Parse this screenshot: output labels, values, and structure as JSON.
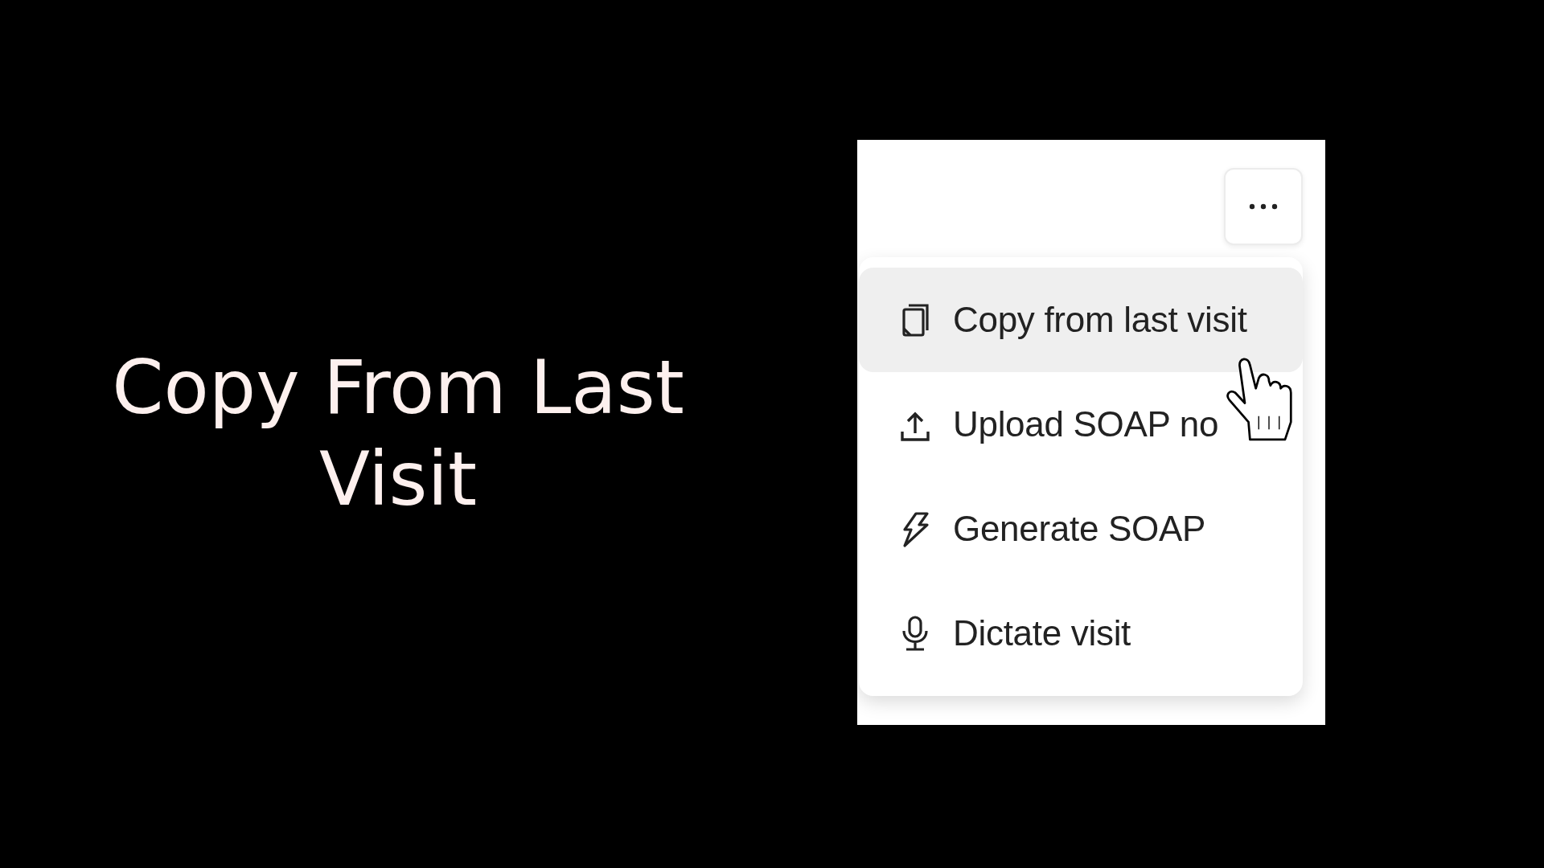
{
  "title": "Copy From Last Visit",
  "menu": {
    "items": [
      {
        "kind": "copy",
        "label": "Copy from last visit",
        "selected": true
      },
      {
        "kind": "upload",
        "label": "Upload SOAP no",
        "selected": false
      },
      {
        "kind": "generate",
        "label": "Generate SOAP",
        "selected": false
      },
      {
        "kind": "dictate",
        "label": "Dictate visit",
        "selected": false
      }
    ]
  }
}
